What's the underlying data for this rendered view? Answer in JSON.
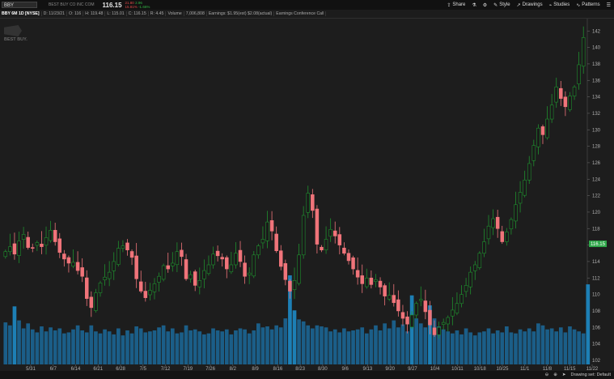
{
  "header": {
    "symbol_input": "BBY",
    "company": "BEST BUY CO INC COM",
    "last_price": "116.15",
    "change_line1": "21.80",
    "change_line2": "15.81%",
    "change_line3": "2.96",
    "change_line4": "-1.66%"
  },
  "toolbar": {
    "share": "Share",
    "style": "Style",
    "drawings": "Drawings",
    "studies": "Studies",
    "patterns": "Patterns"
  },
  "status": {
    "symbol": "BBY 6M 1D [NYSE]",
    "date": "D: 11/23/21",
    "open": "O: 116",
    "high": "H: 119.48",
    "low": "L: 115.01",
    "close": "C: 116.15",
    "range": "R: 4.45",
    "volume_label": "Volume",
    "volume": "7,006,808",
    "earnings": "Earnings: $1.95(est) $2.08(actual)",
    "conference": "Earnings Conference Call"
  },
  "logo_text": "BEST BUY.",
  "footer": {
    "drawing_set": "Drawing set: Default"
  },
  "colors": {
    "up": "#1f8f2e",
    "down": "#f0747a",
    "volume": "#1b5e88",
    "volume_hi": "#1d7fb5",
    "price_tag": "#2fa84a"
  },
  "chart_data": {
    "type": "candlestick",
    "y_ticks": [
      102,
      104,
      106,
      108,
      110,
      112,
      114,
      116,
      118,
      120,
      122,
      124,
      126,
      128,
      130,
      132,
      134,
      136,
      138,
      140,
      142
    ],
    "ylim": [
      101.5,
      143.5
    ],
    "x_ticks": [
      "5/31",
      "6/7",
      "6/14",
      "6/21",
      "6/28",
      "7/5",
      "7/12",
      "7/19",
      "7/26",
      "8/2",
      "8/9",
      "8/16",
      "8/23",
      "8/30",
      "9/6",
      "9/13",
      "9/20",
      "9/27",
      "10/4",
      "10/11",
      "10/18",
      "10/25",
      "11/1",
      "11/8",
      "11/15",
      "11/22"
    ],
    "last_price_label": "116.15",
    "close": [
      115.2,
      115.8,
      114.9,
      116.5,
      117.3,
      115.7,
      115.6,
      116.3,
      115.8,
      116.9,
      117.8,
      116.4,
      115.1,
      114.3,
      113.8,
      113.9,
      112.9,
      112.2,
      109.5,
      108.4,
      110.2,
      111.4,
      112.1,
      112.7,
      114.0,
      115.6,
      115.9,
      115.4,
      114.5,
      111.9,
      110.4,
      109.6,
      110.5,
      111.3,
      112.2,
      113.5,
      113.1,
      113.8,
      115.2,
      114.6,
      111.9,
      112.4,
      111.1,
      111.7,
      112.9,
      113.6,
      114.9,
      114.7,
      114.3,
      113.1,
      113.6,
      115.0,
      114.0,
      112.2,
      112.6,
      114.8,
      115.9,
      116.7,
      118.8,
      117.7,
      115.3,
      113.4,
      111.8,
      110.4,
      111.7,
      114.8,
      119.6,
      122.3,
      120.2,
      116.1,
      115.4,
      116.7,
      117.9,
      117.1,
      116.0,
      115.0,
      114.1,
      113.1,
      112.1,
      111.3,
      112.0,
      111.2,
      111.8,
      110.9,
      109.8,
      109.9,
      109.0,
      108.0,
      107.1,
      106.4,
      107.5,
      108.9,
      109.4,
      107.9,
      106.3,
      105.1,
      106.0,
      106.6,
      107.2,
      108.1,
      108.9,
      110.0,
      111.1,
      112.7,
      113.6,
      115.0,
      116.4,
      118.3,
      119.2,
      118.0,
      116.4,
      117.6,
      119.1,
      120.9,
      122.4,
      123.9,
      125.9,
      128.1,
      130.2,
      129.4,
      131.3,
      133.0,
      135.2,
      133.8,
      132.8,
      134.1,
      135.2,
      137.9,
      141.2
    ],
    "volume_millions": [
      4.2,
      3.9,
      5.8,
      4.4,
      3.6,
      4.1,
      3.5,
      3.2,
      3.8,
      3.3,
      3.7,
      3.4,
      3.6,
      3.1,
      3.2,
      3.5,
      3.9,
      3.4,
      3.2,
      3.9,
      3.3,
      3.1,
      3.5,
      3.3,
      3.0,
      3.6,
      2.9,
      3.4,
      3.1,
      3.8,
      3.6,
      3.2,
      3.3,
      3.4,
      3.7,
      3.9,
      3.3,
      3.6,
      3.1,
      3.2,
      3.9,
      3.4,
      3.5,
      3.3,
      3.0,
      3.1,
      3.6,
      3.4,
      3.3,
      3.5,
      3.0,
      3.4,
      3.6,
      3.5,
      3.1,
      3.4,
      4.1,
      3.7,
      3.8,
      3.5,
      3.9,
      3.7,
      4.6,
      8.9,
      5.4,
      4.5,
      4.3,
      3.9,
      3.6,
      3.9,
      3.8,
      3.7,
      3.3,
      3.5,
      3.2,
      3.6,
      3.3,
      3.4,
      3.5,
      3.7,
      3.1,
      3.5,
      3.9,
      3.4,
      4.1,
      3.6,
      4.4,
      3.7,
      4.0,
      3.3,
      6.9,
      4.6,
      4.1,
      3.7,
      5.9,
      4.6,
      3.8,
      3.5,
      3.3,
      3.1,
      3.4,
      3.0,
      3.6,
      3.2,
      2.9,
      3.2,
      3.3,
      3.6,
      3.1,
      3.4,
      3.2,
      3.8,
      3.2,
      3.1,
      3.5,
      3.3,
      3.6,
      3.3,
      4.1,
      3.9,
      3.5,
      3.6,
      3.3,
      3.7,
      3.2,
      3.8,
      3.5,
      3.3,
      3.1,
      8.0
    ]
  }
}
